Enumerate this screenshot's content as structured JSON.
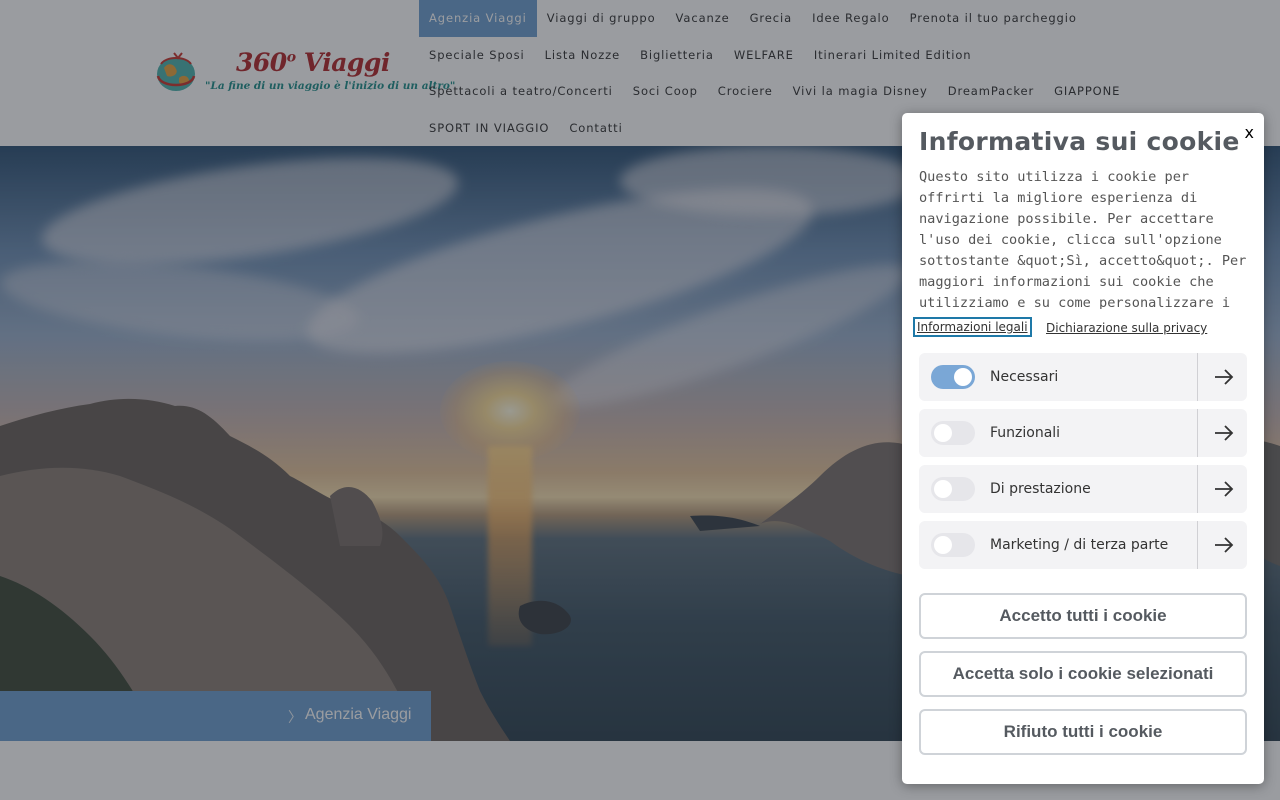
{
  "logo": {
    "title": "360",
    "degree": "o",
    "title_suffix": " Viaggi",
    "tagline": "\"La fine di un viaggio è l'inizio di un altro\""
  },
  "nav": {
    "rows": [
      [
        "Agenzia Viaggi",
        "Viaggi di gruppo",
        "Vacanze",
        "Grecia",
        "Idee Regalo",
        "Prenota il tuo parcheggio"
      ],
      [
        "Speciale Sposi",
        "Lista Nozze",
        "Biglietteria",
        "WELFARE",
        "Itinerari Limited Edition"
      ],
      [
        "Spettacoli a teatro/Concerti",
        "Soci Coop",
        "Crociere",
        "Vivi la magia Disney",
        "DreamPacker",
        "GIAPPONE"
      ],
      [
        "SPORT IN VIAGGIO",
        "Contatti"
      ]
    ],
    "active": "Agenzia Viaggi"
  },
  "breadcrumb": {
    "separator": "〉",
    "current": "Agenzia Viaggi"
  },
  "cookie": {
    "close": "x",
    "title": "Informativa sui cookie",
    "text": "Questo sito utilizza i cookie per offrirti la migliore esperienza di navigazione possibile. Per accettare l'uso dei cookie, clicca sull'opzione sottostante &quot;Sì, accetto&quot;. Per maggiori informazioni sui cookie che utilizziamo e su come personalizzare i parametri relativi al loro uso,",
    "link_legal": "Informazioni legali",
    "link_privacy": "Dichiarazione sulla privacy",
    "categories": [
      {
        "label": "Necessari",
        "enabled": true
      },
      {
        "label": "Funzionali",
        "enabled": false
      },
      {
        "label": "Di prestazione",
        "enabled": false
      },
      {
        "label": "Marketing / di terza parte",
        "enabled": false
      }
    ],
    "buttons": {
      "accept_all": "Accetto tutti i cookie",
      "accept_selected": "Accetta solo i cookie selezionati",
      "reject_all": "Rifiuto tutti i cookie"
    }
  },
  "colors": {
    "accent": "#6d9fcf",
    "logo_red": "#b3292c",
    "logo_teal": "#1f8f8a",
    "toggle_on": "#7aa7d6"
  },
  "icons": {
    "category_arrow": "arrow-right-icon",
    "logo_globe": "globe-icon"
  }
}
